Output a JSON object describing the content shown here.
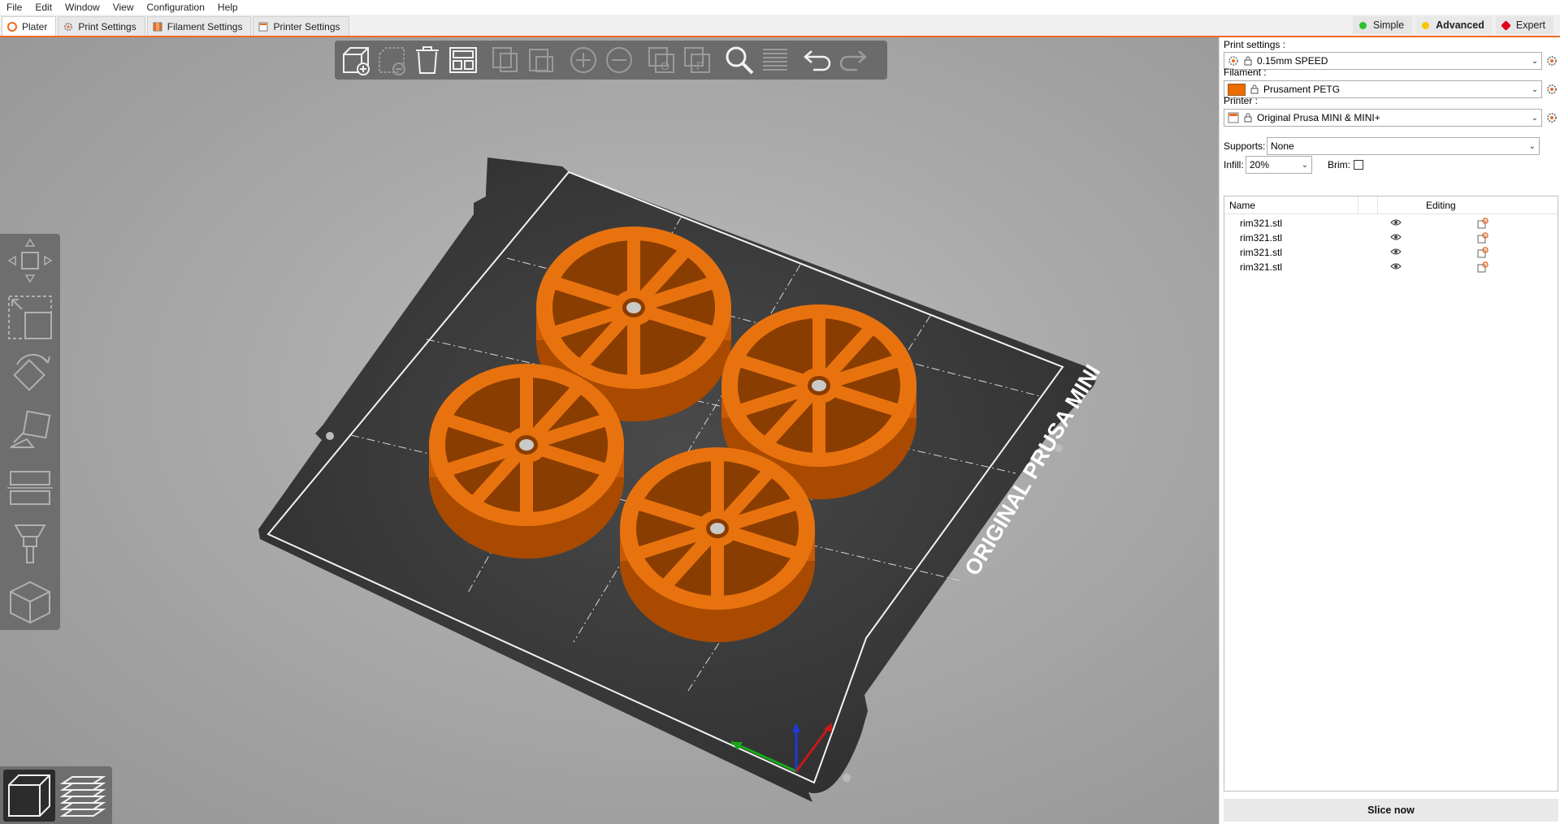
{
  "menu": [
    "File",
    "Edit",
    "Window",
    "View",
    "Configuration",
    "Help"
  ],
  "tabs": [
    {
      "label": "Plater",
      "active": true
    },
    {
      "label": "Print Settings",
      "active": false
    },
    {
      "label": "Filament Settings",
      "active": false
    },
    {
      "label": "Printer Settings",
      "active": false
    }
  ],
  "modes": [
    {
      "label": "Simple",
      "color": "#2bc22b",
      "active": false
    },
    {
      "label": "Advanced",
      "color": "#f5c800",
      "active": true
    },
    {
      "label": "Expert",
      "color": "#e0001a",
      "active": false
    }
  ],
  "sidebar": {
    "print_settings_label": "Print settings :",
    "print_settings_value": "0.15mm SPEED",
    "filament_label": "Filament :",
    "filament_value": "Prusament PETG",
    "filament_color": "#ed6b00",
    "printer_label": "Printer :",
    "printer_value": "Original Prusa MINI & MINI+",
    "supports_label": "Supports:",
    "supports_value": "None",
    "infill_label": "Infill:",
    "infill_value": "20%",
    "brim_label": "Brim:",
    "brim_checked": false
  },
  "object_list": {
    "columns": {
      "name": "Name",
      "editing": "Editing"
    },
    "objects": [
      "rim321.stl",
      "rim321.stl",
      "rim321.stl",
      "rim321.stl"
    ]
  },
  "slice_button": "Slice now",
  "bed_label": "ORIGINAL PRUSA MINI",
  "accent_color": "#ed6b21",
  "model_color": "#e8730e"
}
